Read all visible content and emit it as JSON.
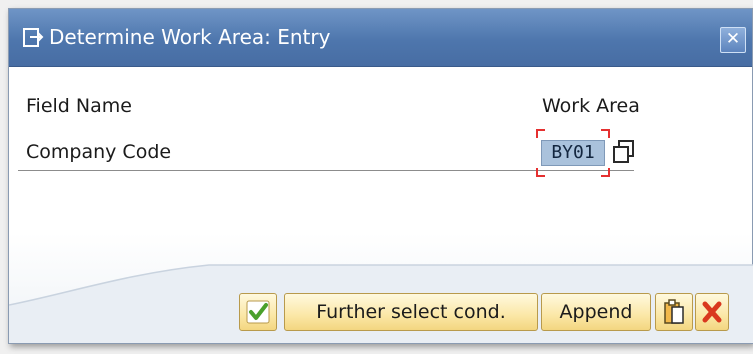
{
  "dialog": {
    "title": "Determine Work Area: Entry",
    "close_icon": "close-icon"
  },
  "table": {
    "headers": {
      "field_name": "Field Name",
      "work_area": "Work Area"
    },
    "rows": [
      {
        "field": "Company Code",
        "value": "BY01"
      }
    ]
  },
  "buttons": {
    "continue_icon": "checkmark-icon",
    "further": "Further select cond.",
    "append": "Append",
    "paste_icon": "paste-icon",
    "cancel_icon": "cancel-icon"
  },
  "colors": {
    "title_bar": "#4e76ad",
    "button_face": "#fbe7a6",
    "input_highlight": "#aac2dc",
    "focus_corners": "#e53030",
    "check_green": "#4aa02c",
    "cancel_red": "#d9381e"
  }
}
